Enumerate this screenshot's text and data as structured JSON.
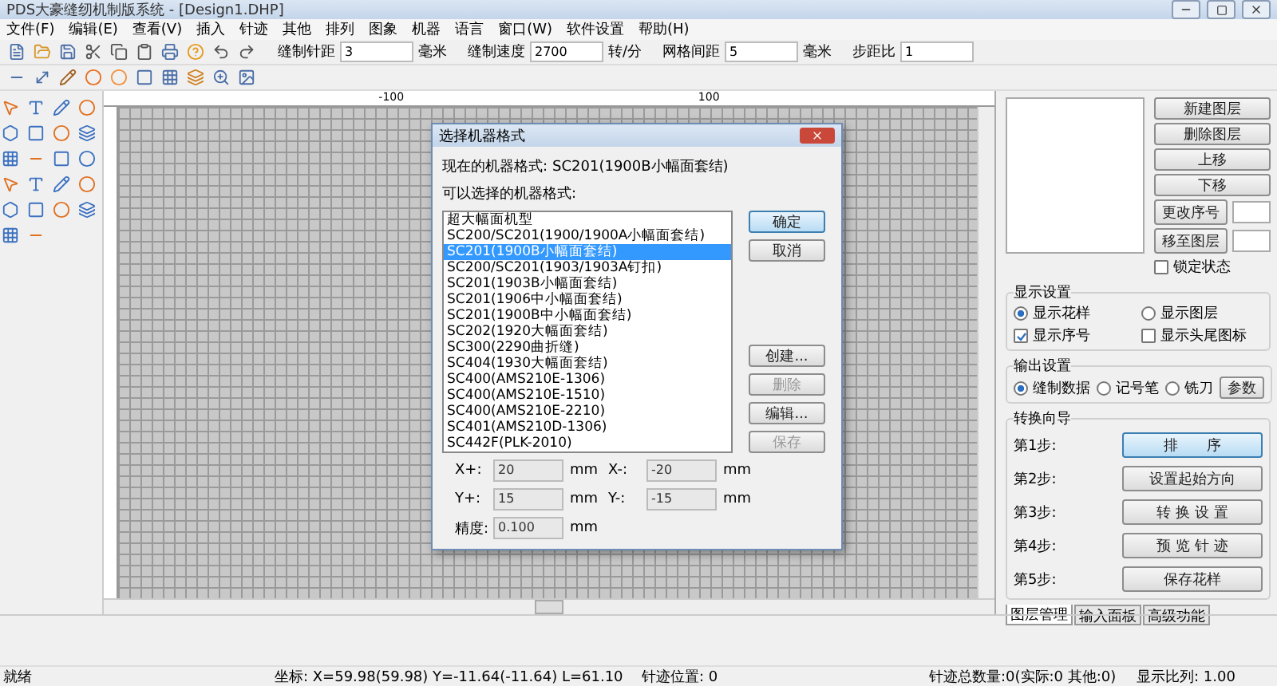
{
  "window": {
    "title": "PDS大豪缝纫机制版系统 - [Design1.DHP]"
  },
  "menu": [
    "文件(F)",
    "编辑(E)",
    "查看(V)",
    "插入",
    "针迹",
    "其他",
    "排列",
    "图象",
    "机器",
    "语言",
    "窗口(W)",
    "软件设置",
    "帮助(H)"
  ],
  "toolbar_fields": [
    {
      "label": "缝制针距",
      "value": "3",
      "unit": "毫米"
    },
    {
      "label": "缝制速度",
      "value": "2700",
      "unit": "转/分"
    },
    {
      "label": "网格间距",
      "value": "5",
      "unit": "毫米"
    },
    {
      "label": "步距比",
      "value": "1"
    }
  ],
  "ruler": {
    "labels": [
      "-100",
      "100"
    ]
  },
  "dialog": {
    "title": "选择机器格式",
    "current_label": "现在的机器格式:",
    "current_value": "SC201(1900B小幅面套结)",
    "list_label": "可以选择的机器格式:",
    "items": [
      {
        "label": "超大幅面机型",
        "selected": false
      },
      {
        "label": "SC200/SC201(1900/1900A小幅面套结)",
        "selected": false
      },
      {
        "label": "SC201(1900B小幅面套结)",
        "selected": true
      },
      {
        "label": "SC200/SC201(1903/1903A钉扣)",
        "selected": false
      },
      {
        "label": "SC201(1903B小幅面套结)",
        "selected": false
      },
      {
        "label": "SC201(1906中小幅面套结)",
        "selected": false
      },
      {
        "label": "SC201(1900B中小幅面套结)",
        "selected": false
      },
      {
        "label": "SC202(1920大幅面套结)",
        "selected": false
      },
      {
        "label": "SC300(2290曲折缝)",
        "selected": false
      },
      {
        "label": "SC404(1930大幅面套结)",
        "selected": false
      },
      {
        "label": "SC400(AMS210E-1306)",
        "selected": false
      },
      {
        "label": "SC400(AMS210E-1510)",
        "selected": false
      },
      {
        "label": "SC400(AMS210E-2210)",
        "selected": false
      },
      {
        "label": "SC401(AMS210D-1306)",
        "selected": false
      },
      {
        "label": "SC442F(PLK-2010)",
        "selected": false
      }
    ],
    "buttons": [
      {
        "label": "确定",
        "disabled": false,
        "default": true
      },
      {
        "label": "取消",
        "disabled": false,
        "default": false
      },
      {
        "label": "创建...",
        "disabled": false,
        "default": false
      },
      {
        "label": "删除",
        "disabled": true,
        "default": false
      },
      {
        "label": "编辑...",
        "disabled": false,
        "default": false
      },
      {
        "label": "保存",
        "disabled": true,
        "default": false
      }
    ],
    "fields": [
      {
        "label": "X+:",
        "value": "20",
        "unit": "mm"
      },
      {
        "label": "X-:",
        "value": "-20",
        "unit": "mm"
      },
      {
        "label": "Y+:",
        "value": "15",
        "unit": "mm"
      },
      {
        "label": "Y-:",
        "value": "-15",
        "unit": "mm"
      }
    ],
    "precision": {
      "label": "精度:",
      "value": "0.100",
      "unit": "mm"
    }
  },
  "layer_panel": {
    "buttons": [
      "新建图层",
      "删除图层",
      "上移",
      "下移"
    ],
    "order_buttons": [
      "更改序号",
      "移至图层"
    ],
    "lock": {
      "label": "锁定状态",
      "checked": false
    },
    "display": {
      "title": "显示设置",
      "options": [
        {
          "kind": "radio",
          "label": "显示花样",
          "checked": true
        },
        {
          "kind": "radio",
          "label": "显示图层",
          "checked": false
        },
        {
          "kind": "checkbox",
          "label": "显示序号",
          "checked": true
        },
        {
          "kind": "checkbox",
          "label": "显示头尾图标",
          "checked": false
        }
      ]
    },
    "output": {
      "title": "输出设置",
      "options": [
        {
          "label": "缝制数据",
          "selected": true
        },
        {
          "label": "记号笔",
          "selected": false
        },
        {
          "label": "铣刀",
          "selected": false
        }
      ],
      "button": "参数"
    },
    "wizard": {
      "title": "转换向导",
      "steps": [
        {
          "label": "第1步:",
          "button": "排　　序",
          "focused": true
        },
        {
          "label": "第2步:",
          "button": "设置起始方向",
          "focused": false
        },
        {
          "label": "第3步:",
          "button": "转 换 设 置",
          "focused": false
        },
        {
          "label": "第4步:",
          "button": "预 览 针 迹",
          "focused": false
        },
        {
          "label": "第5步:",
          "button": "保存花样",
          "focused": false
        }
      ]
    },
    "tabs": [
      {
        "label": "图层管理",
        "selected": true
      },
      {
        "label": "输入面板",
        "selected": false
      },
      {
        "label": "高级功能",
        "selected": false
      }
    ]
  },
  "status_bar": [
    "就绪",
    "坐标: X=59.98(59.98) Y=-11.64(-11.64) L=61.10",
    "针迹位置: 0",
    "针迹总数量:0(实际:0 其他:0)",
    "显示比列: 1.00"
  ]
}
